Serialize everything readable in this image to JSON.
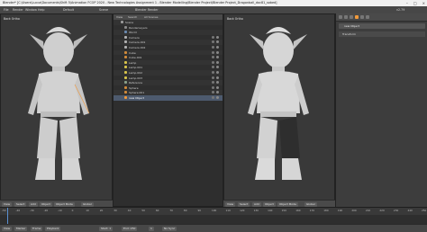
{
  "window": {
    "title": "Blender* [C:\\Users\\Lucca\\Documents\\Shift 5\\Animation FCOP 2020 - New Technologies Assignment 1 - Blender Modelling\\Blender Project\\Blender Project_Dragonball_doc81_sobed]"
  },
  "menu": {
    "items": [
      "File",
      "Render",
      "Window",
      "Help",
      "Default",
      "Scene",
      "Blender Render",
      "v2.79"
    ]
  },
  "left_viewport": {
    "label": "Back Ortho",
    "object": "(3) new Object",
    "header": [
      "View",
      "Select",
      "Add",
      "Object",
      "Object Mode",
      "Global"
    ]
  },
  "right_viewport": {
    "label": "Back Ortho",
    "object": "(3) new Object",
    "header": [
      "View",
      "Select",
      "Add",
      "Object",
      "Object Mode",
      "Global"
    ]
  },
  "outliner": {
    "header": [
      "View",
      "Search",
      "All Scenes"
    ],
    "rows": [
      "Scene",
      "RenderLayers",
      "World",
      "Camera",
      "Camera.001",
      "Camera.002",
      "Cube",
      "Cube.001",
      "Lamp",
      "Lamp.001",
      "Lamp.002",
      "Lamp.003",
      "Reference",
      "Sphere",
      "Sphere.001",
      "new Object"
    ]
  },
  "properties": {
    "header": [
      "Render",
      "Scene",
      "World",
      "Object",
      "Modifiers",
      "Material"
    ],
    "object_name": "new Object",
    "section": "Transform"
  },
  "timeline": {
    "ticks": [
      "-50",
      "-40",
      "-30",
      "-20",
      "-10",
      "0",
      "10",
      "20",
      "30",
      "40",
      "50",
      "60",
      "70",
      "80",
      "90",
      "100",
      "110",
      "120",
      "130",
      "140",
      "150",
      "160",
      "170",
      "180",
      "190",
      "200",
      "210",
      "220",
      "230",
      "240",
      "250"
    ],
    "controls": [
      "View",
      "Marker",
      "Frame",
      "Playback",
      "Start: 1",
      "End: 250",
      "1",
      "No Sync"
    ]
  },
  "colors": {
    "accent": "#5a8fd0",
    "selected": "#f29a3a"
  }
}
